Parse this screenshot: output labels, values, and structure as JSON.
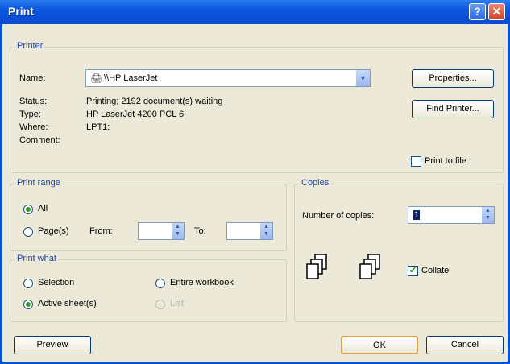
{
  "window": {
    "title": "Print",
    "help_glyph": "?",
    "close_glyph": "✕"
  },
  "printer": {
    "legend": "Printer",
    "name_label": "Name:",
    "name_value": "\\\\HP LaserJet",
    "status_label": "Status:",
    "status_value": "Printing; 2192 document(s) waiting",
    "type_label": "Type:",
    "type_value": "HP LaserJet 4200 PCL 6",
    "where_label": "Where:",
    "where_value": "LPT1:",
    "comment_label": "Comment:",
    "properties_button": "Properties...",
    "find_printer_button": "Find Printer...",
    "print_to_file_label": "Print to file"
  },
  "print_range": {
    "legend": "Print range",
    "all_label": "All",
    "pages_label": "Page(s)",
    "from_label": "From:",
    "to_label": "To:",
    "selected": "All"
  },
  "print_what": {
    "legend": "Print what",
    "selection_label": "Selection",
    "entire_workbook_label": "Entire workbook",
    "active_sheets_label": "Active sheet(s)",
    "list_label": "List",
    "selected": "Active sheet(s)"
  },
  "copies": {
    "legend": "Copies",
    "number_label": "Number of copies:",
    "number_value": "1",
    "collate_label": "Collate",
    "collate_checked": true
  },
  "footer": {
    "preview_button": "Preview",
    "ok_button": "OK",
    "cancel_button": "Cancel"
  }
}
